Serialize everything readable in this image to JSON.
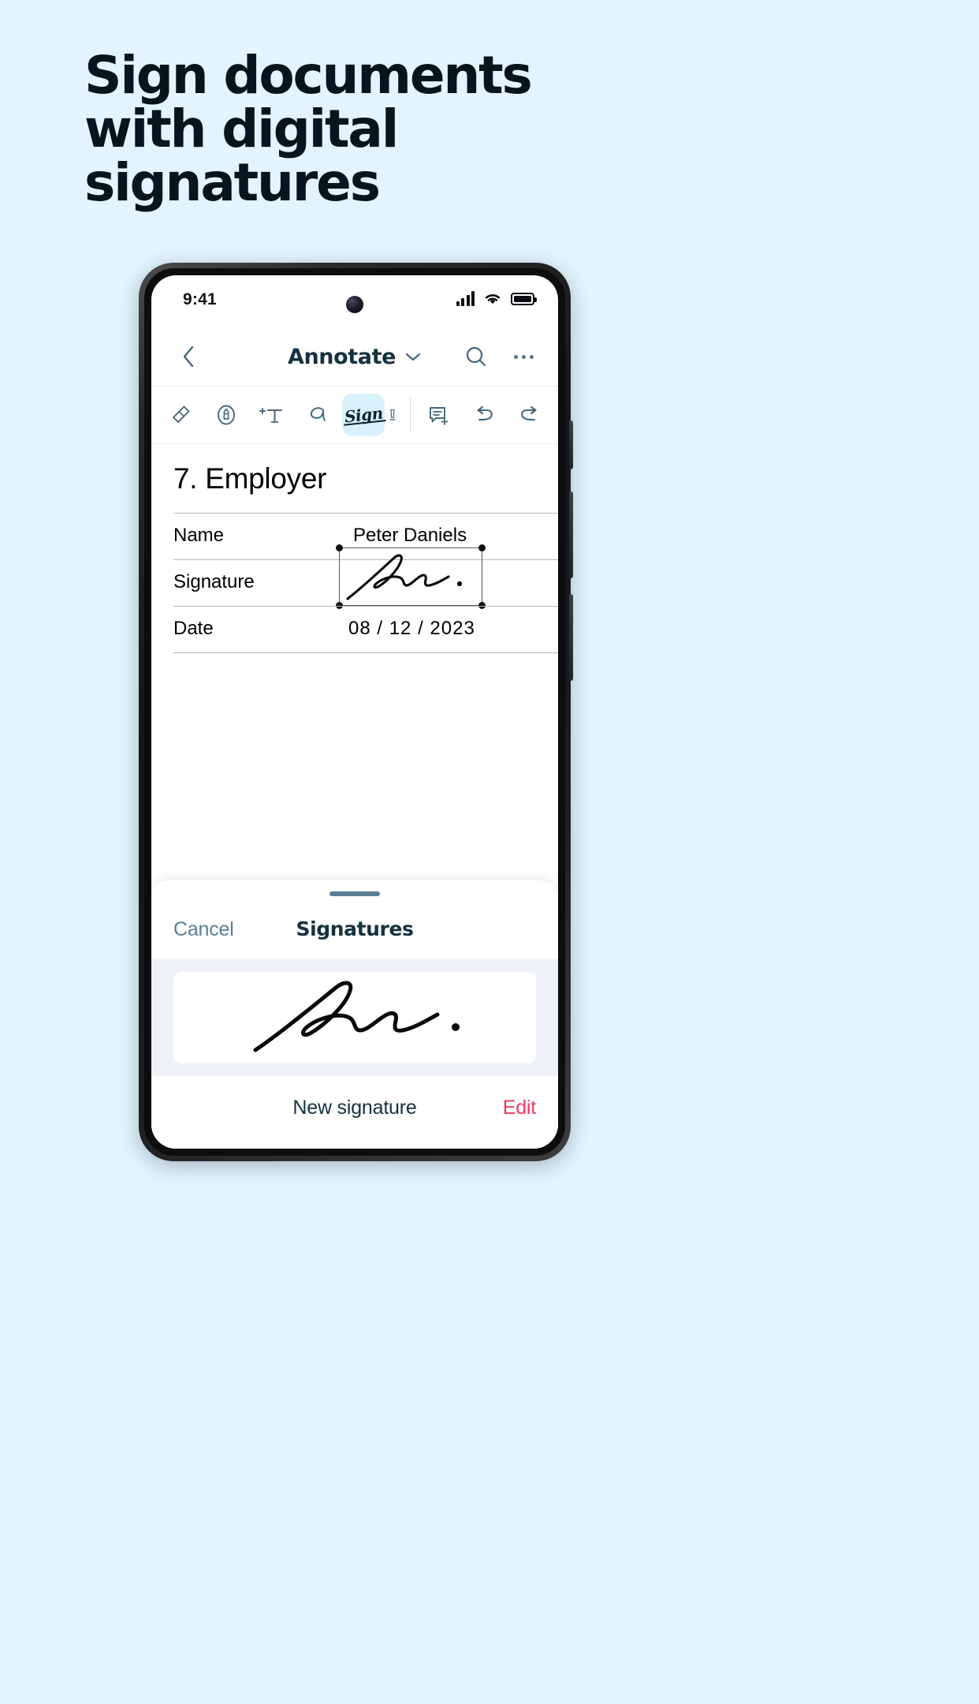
{
  "marketing": {
    "headline_lines": [
      "Sign documents",
      "with digital",
      "signatures"
    ],
    "background_color": "#e4f4fd",
    "text_color": "#07161c"
  },
  "phone": {
    "status_bar": {
      "time": "9:41",
      "icons": [
        "signal-bars-icon",
        "wifi-icon",
        "battery-icon"
      ]
    },
    "nav_bar": {
      "back_icon": "chevron-left-icon",
      "title": "Annotate",
      "title_chevron_icon": "chevron-down-icon",
      "search_icon": "search-icon",
      "more_icon": "more-horizontal-icon"
    },
    "toolbar": {
      "tools": [
        {
          "name": "eraser-icon",
          "label": "Eraser",
          "active": false
        },
        {
          "name": "pen-circle-icon",
          "label": "Ink",
          "active": false
        },
        {
          "name": "add-text-icon",
          "label": "+T",
          "active": false
        },
        {
          "name": "freehand-icon",
          "label": "Draw",
          "active": false
        },
        {
          "name": "sign-icon",
          "label": "Sign",
          "active": true
        },
        {
          "name": "highlight-icon",
          "label": "",
          "active": false
        },
        {
          "name": "comment-add-icon",
          "label": "Comment",
          "active": false
        },
        {
          "name": "undo-icon",
          "label": "Undo",
          "active": false
        },
        {
          "name": "redo-icon",
          "label": "Redo",
          "active": false
        }
      ],
      "active_tool_bg": "#d9f1fb"
    },
    "document": {
      "heading": "7. Employer",
      "rows": [
        {
          "label": "Name",
          "value": "Peter Daniels",
          "type": "text"
        },
        {
          "label": "Signature",
          "value": "",
          "type": "signature"
        },
        {
          "label": "Date",
          "value": "08 / 12 / 2023",
          "type": "text"
        }
      ]
    },
    "sheet": {
      "grabber": "sheet-grabber",
      "cancel_label": "Cancel",
      "title": "Signatures",
      "saved_signatures": [
        {
          "name": "saved-signature-1"
        }
      ],
      "new_signature_label": "New signature",
      "edit_label": "Edit",
      "edit_color": "#f03a5f"
    }
  }
}
